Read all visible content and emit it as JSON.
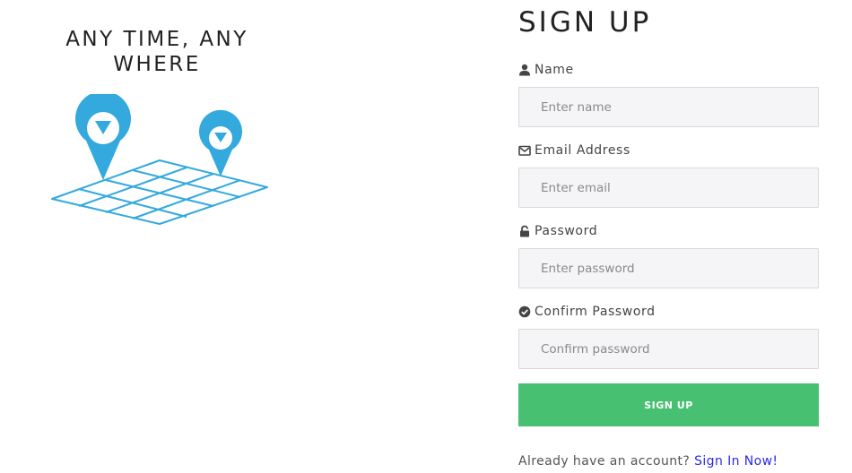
{
  "left": {
    "tagline": "ANY TIME, ANY WHERE"
  },
  "colors": {
    "accent_blue": "#34a9de",
    "button_green": "#48c072",
    "link_blue": "#2a2ae6",
    "input_bg": "#f5f5f7"
  },
  "form": {
    "title": "SIGN UP",
    "fields": [
      {
        "icon": "user-icon",
        "label": "Name",
        "placeholder": "Enter name"
      },
      {
        "icon": "envelope-icon",
        "label": "Email Address",
        "placeholder": "Enter email"
      },
      {
        "icon": "lock-icon",
        "label": "Password",
        "placeholder": "Enter password"
      },
      {
        "icon": "check-circle-icon",
        "label": "Confirm Password",
        "placeholder": "Confirm password"
      }
    ],
    "submit_label": "SIGN UP",
    "footer_text": "Already have an account?",
    "footer_link": "Sign In Now!"
  }
}
